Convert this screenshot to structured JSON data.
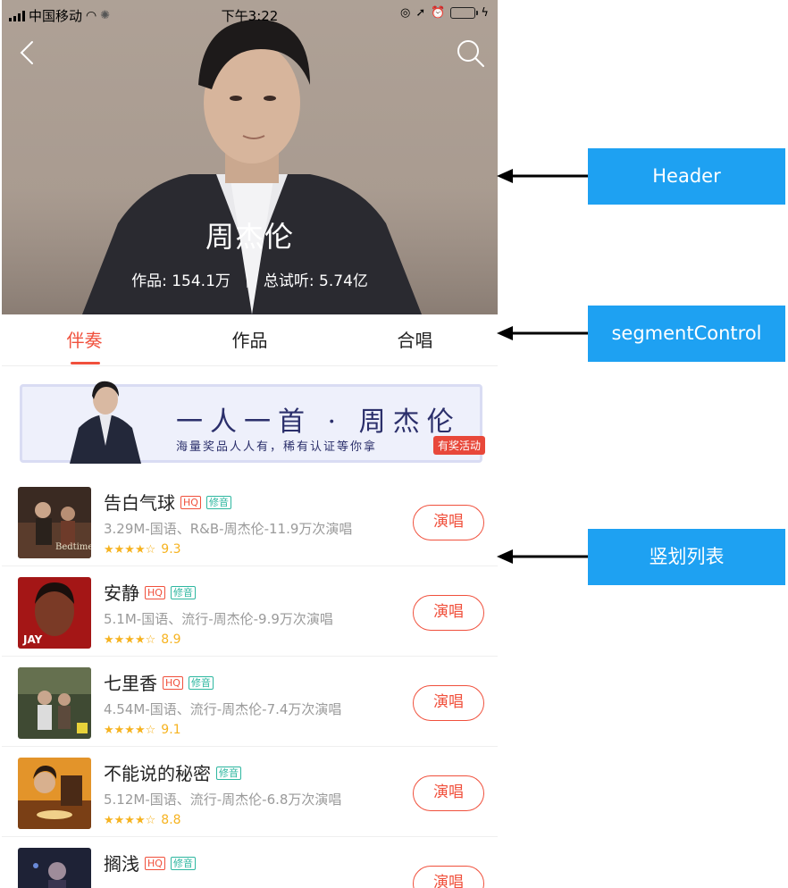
{
  "status_bar": {
    "carrier": "中国移动",
    "time": "下午3:22"
  },
  "header": {
    "artist_name": "周杰伦",
    "works_label": "作品: 154.1万",
    "plays_label": "总试听: 5.74亿"
  },
  "segment": {
    "tabs": [
      "伴奏",
      "作品",
      "合唱"
    ],
    "active_index": 0
  },
  "banner": {
    "title": "一人一首 · 周杰伦",
    "subtitle": "海量奖品人人有，稀有认证等你拿",
    "badge": "有奖活动"
  },
  "songs": [
    {
      "title": "告白气球",
      "hq": "HQ",
      "xiuyin": "修音",
      "meta": "3.29M-国语、R&B-周杰伦-11.9万次演唱",
      "stars": "★★★★☆",
      "score": "9.3",
      "action": "演唱"
    },
    {
      "title": "安静",
      "hq": "HQ",
      "xiuyin": "修音",
      "meta": "5.1M-国语、流行-周杰伦-9.9万次演唱",
      "stars": "★★★★☆",
      "score": "8.9",
      "action": "演唱"
    },
    {
      "title": "七里香",
      "hq": "HQ",
      "xiuyin": "修音",
      "meta": "4.54M-国语、流行-周杰伦-7.4万次演唱",
      "stars": "★★★★☆",
      "score": "9.1",
      "action": "演唱"
    },
    {
      "title": "不能说的秘密",
      "xiuyin": "修音",
      "meta": "5.12M-国语、流行-周杰伦-6.8万次演唱",
      "stars": "★★★★☆",
      "score": "8.8",
      "action": "演唱"
    },
    {
      "title": "搁浅",
      "hq": "HQ",
      "xiuyin": "修音",
      "meta": "",
      "stars": "",
      "score": "",
      "action": "演唱"
    }
  ],
  "annotations": {
    "header": "Header",
    "segment": "segmentControl",
    "list": "竖划列表"
  },
  "colors": {
    "accent": "#f0503c",
    "annotation_blue": "#1ea1f2",
    "star": "#f6b320",
    "tag_green": "#2eb7a0"
  }
}
